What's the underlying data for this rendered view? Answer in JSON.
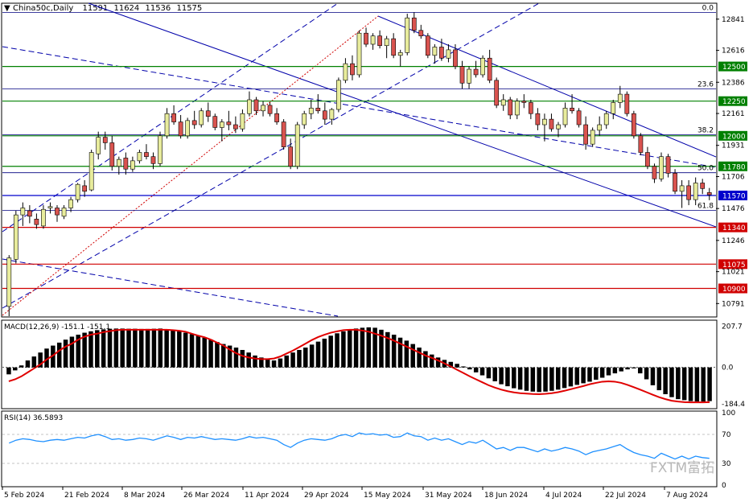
{
  "header": {
    "symbol": "China50c,Daily",
    "open": "11591",
    "high": "11624",
    "low": "11536",
    "close": "11575"
  },
  "watermark": "FXTM富拓",
  "colors": {
    "bull_body": "#e8ec9c",
    "bear_body": "#d9534f",
    "candle_outline": "#000000",
    "support_line": "#d00000",
    "resistance_line": "#008000",
    "current_price_line": "#0000cc",
    "fib_line": "#000080",
    "channel_line": "#0000aa",
    "macd_signal": "#e00000",
    "rsi_line": "#1e90ff"
  },
  "chart_data": {
    "type": "candlestick",
    "ylim": [
      10700,
      12950
    ],
    "y_ticks": [
      12841,
      12616,
      12386,
      12161,
      11931,
      11706,
      11476,
      11246,
      11021,
      10791
    ],
    "x_ticks": [
      "5 Feb 2024",
      "21 Feb 2024",
      "8 Mar 2024",
      "26 Mar 2024",
      "11 Apr 2024",
      "29 Apr 2024",
      "15 May 2024",
      "31 May 2024",
      "18 Jun 2024",
      "4 Jul 2024",
      "22 Jul 2024",
      "7 Aug 2024"
    ],
    "horizontal_levels": [
      {
        "value": 12500,
        "label": "12500",
        "kind": "resistance"
      },
      {
        "value": 12250,
        "label": "12250",
        "kind": "resistance"
      },
      {
        "value": 12000,
        "label": "12000",
        "kind": "resistance"
      },
      {
        "value": 11780,
        "label": "11780",
        "kind": "resistance"
      },
      {
        "value": 11570,
        "label": "11570",
        "kind": "current"
      },
      {
        "value": 11340,
        "label": "11340",
        "kind": "support"
      },
      {
        "value": 11075,
        "label": "11075",
        "kind": "support"
      },
      {
        "value": 10900,
        "label": "10900",
        "kind": "support"
      }
    ],
    "fib_levels": [
      {
        "label": "0.0",
        "value": 12890
      },
      {
        "label": "23.6",
        "value": 12338
      },
      {
        "label": "38.2",
        "value": 12007
      },
      {
        "label": "50.0",
        "value": 11734
      },
      {
        "label": "61.8",
        "value": 11462
      }
    ],
    "fib_anchor": {
      "high": 12890
    },
    "ohlc": [
      [
        10770,
        11140,
        10700,
        11120
      ],
      [
        11110,
        11460,
        11080,
        11430
      ],
      [
        11430,
        11520,
        11350,
        11480
      ],
      [
        11460,
        11500,
        11370,
        11420
      ],
      [
        11400,
        11440,
        11330,
        11360
      ],
      [
        11350,
        11500,
        11330,
        11470
      ],
      [
        11480,
        11520,
        11440,
        11490
      ],
      [
        11480,
        11500,
        11380,
        11430
      ],
      [
        11420,
        11500,
        11400,
        11480
      ],
      [
        11480,
        11560,
        11450,
        11540
      ],
      [
        11540,
        11660,
        11520,
        11650
      ],
      [
        11640,
        11680,
        11560,
        11600
      ],
      [
        11610,
        11900,
        11600,
        11880
      ],
      [
        11870,
        12030,
        11830,
        11990
      ],
      [
        11990,
        12030,
        11900,
        11950
      ],
      [
        11950,
        12000,
        11750,
        11780
      ],
      [
        11780,
        11850,
        11720,
        11830
      ],
      [
        11840,
        11880,
        11720,
        11760
      ],
      [
        11760,
        11850,
        11740,
        11820
      ],
      [
        11820,
        11900,
        11800,
        11880
      ],
      [
        11880,
        11940,
        11830,
        11850
      ],
      [
        11850,
        11880,
        11760,
        11800
      ],
      [
        11800,
        12030,
        11780,
        12000
      ],
      [
        12000,
        12200,
        11980,
        12160
      ],
      [
        12160,
        12220,
        12080,
        12100
      ],
      [
        12100,
        12150,
        11980,
        12000
      ],
      [
        12000,
        12130,
        11980,
        12110
      ],
      [
        12110,
        12180,
        12050,
        12080
      ],
      [
        12080,
        12200,
        12060,
        12180
      ],
      [
        12180,
        12240,
        12100,
        12140
      ],
      [
        12140,
        12160,
        12040,
        12060
      ],
      [
        12060,
        12120,
        11960,
        12100
      ],
      [
        12100,
        12180,
        12040,
        12080
      ],
      [
        12080,
        12140,
        12020,
        12050
      ],
      [
        12050,
        12190,
        12030,
        12160
      ],
      [
        12160,
        12320,
        12140,
        12260
      ],
      [
        12260,
        12280,
        12150,
        12180
      ],
      [
        12180,
        12250,
        12140,
        12220
      ],
      [
        12220,
        12240,
        12140,
        12160
      ],
      [
        12160,
        12200,
        12080,
        12100
      ],
      [
        12100,
        12120,
        11900,
        11920
      ],
      [
        11920,
        11980,
        11760,
        11780
      ],
      [
        11780,
        12100,
        11760,
        12080
      ],
      [
        12080,
        12180,
        12050,
        12160
      ],
      [
        12160,
        12260,
        12120,
        12200
      ],
      [
        12200,
        12300,
        12160,
        12180
      ],
      [
        12180,
        12240,
        12080,
        12120
      ],
      [
        12120,
        12200,
        12080,
        12190
      ],
      [
        12190,
        12420,
        12170,
        12400
      ],
      [
        12400,
        12560,
        12380,
        12520
      ],
      [
        12520,
        12580,
        12400,
        12440
      ],
      [
        12440,
        12760,
        12420,
        12740
      ],
      [
        12740,
        12780,
        12640,
        12660
      ],
      [
        12660,
        12740,
        12620,
        12720
      ],
      [
        12720,
        12760,
        12630,
        12650
      ],
      [
        12650,
        12720,
        12560,
        12700
      ],
      [
        12700,
        12740,
        12560,
        12580
      ],
      [
        12580,
        12620,
        12500,
        12600
      ],
      [
        12600,
        12880,
        12580,
        12850
      ],
      [
        12850,
        12890,
        12740,
        12760
      ],
      [
        12760,
        12800,
        12700,
        12720
      ],
      [
        12720,
        12740,
        12560,
        12580
      ],
      [
        12580,
        12660,
        12520,
        12640
      ],
      [
        12640,
        12700,
        12540,
        12560
      ],
      [
        12560,
        12660,
        12530,
        12620
      ],
      [
        12620,
        12660,
        12480,
        12500
      ],
      [
        12500,
        12540,
        12340,
        12380
      ],
      [
        12380,
        12500,
        12340,
        12480
      ],
      [
        12480,
        12540,
        12420,
        12440
      ],
      [
        12440,
        12580,
        12420,
        12560
      ],
      [
        12560,
        12620,
        12380,
        12400
      ],
      [
        12400,
        12420,
        12200,
        12220
      ],
      [
        12220,
        12300,
        12180,
        12260
      ],
      [
        12260,
        12280,
        12120,
        12150
      ],
      [
        12150,
        12270,
        12120,
        12250
      ],
      [
        12250,
        12300,
        12200,
        12240
      ],
      [
        12240,
        12260,
        12120,
        12160
      ],
      [
        12160,
        12200,
        12040,
        12080
      ],
      [
        12080,
        12160,
        11960,
        12120
      ],
      [
        12120,
        12160,
        12030,
        12050
      ],
      [
        12050,
        12100,
        11990,
        12080
      ],
      [
        12080,
        12240,
        12060,
        12200
      ],
      [
        12200,
        12300,
        12160,
        12180
      ],
      [
        12180,
        12200,
        12060,
        12080
      ],
      [
        12080,
        12140,
        11900,
        11940
      ],
      [
        11940,
        12060,
        11920,
        12040
      ],
      [
        12040,
        12140,
        12000,
        12080
      ],
      [
        12080,
        12180,
        12050,
        12160
      ],
      [
        12160,
        12260,
        12120,
        12240
      ],
      [
        12240,
        12360,
        12200,
        12300
      ],
      [
        12300,
        12320,
        12140,
        12160
      ],
      [
        12160,
        12180,
        11980,
        12000
      ],
      [
        12000,
        12020,
        11860,
        11880
      ],
      [
        11880,
        11920,
        11760,
        11780
      ],
      [
        11780,
        11800,
        11660,
        11690
      ],
      [
        11690,
        11880,
        11670,
        11850
      ],
      [
        11850,
        11870,
        11700,
        11730
      ],
      [
        11730,
        11760,
        11580,
        11600
      ],
      [
        11600,
        11680,
        11480,
        11640
      ],
      [
        11640,
        11680,
        11500,
        11540
      ],
      [
        11540,
        11700,
        11500,
        11660
      ],
      [
        11660,
        11690,
        11580,
        11620
      ],
      [
        11591,
        11624,
        11536,
        11575
      ]
    ],
    "macd": {
      "label": "MACD(12,26,9) -151.1 -151.1",
      "ylim": [
        -200,
        230
      ],
      "y_ticks": [
        207.7,
        0.0,
        -184.4
      ],
      "hist": [
        -35,
        -15,
        10,
        35,
        55,
        75,
        95,
        110,
        125,
        140,
        155,
        165,
        175,
        182,
        188,
        192,
        195,
        196,
        196,
        195,
        195,
        194,
        194,
        195,
        196,
        193,
        188,
        182,
        175,
        168,
        160,
        150,
        140,
        128,
        118,
        110,
        100,
        88,
        75,
        60,
        50,
        40,
        35,
        45,
        60,
        75,
        88,
        100,
        115,
        130,
        145,
        160,
        172,
        182,
        190,
        196,
        200,
        202,
        200,
        190,
        178,
        165,
        150,
        135,
        118,
        100,
        82,
        65,
        50,
        38,
        28,
        18,
        5,
        -10,
        -25,
        -40,
        -55,
        -70,
        -85,
        -95,
        -105,
        -112,
        -118,
        -122,
        -124,
        -122,
        -118,
        -112,
        -104,
        -96,
        -88,
        -80,
        -72,
        -62,
        -52,
        -40,
        -30,
        -20,
        -10,
        -5,
        -30,
        -60,
        -90,
        -115,
        -135,
        -150,
        -160,
        -165,
        -170,
        -172,
        -172,
        -170
      ],
      "signal": [
        -70,
        -60,
        -45,
        -25,
        -5,
        15,
        40,
        60,
        85,
        105,
        120,
        140,
        155,
        165,
        170,
        178,
        183,
        188,
        190,
        190,
        190,
        190,
        190,
        190,
        190,
        190,
        188,
        185,
        180,
        170,
        160,
        152,
        140,
        125,
        110,
        90,
        72,
        58,
        50,
        45,
        42,
        42,
        45,
        55,
        70,
        85,
        102,
        120,
        138,
        153,
        165,
        175,
        182,
        188,
        190,
        190,
        186,
        180,
        170,
        160,
        148,
        135,
        120,
        105,
        90,
        75,
        60,
        48,
        35,
        20,
        5,
        -12,
        -28,
        -45,
        -60,
        -75,
        -90,
        -102,
        -112,
        -120,
        -126,
        -130,
        -132,
        -134,
        -135,
        -133,
        -130,
        -125,
        -118,
        -110,
        -102,
        -94,
        -85,
        -78,
        -72,
        -70,
        -72,
        -78,
        -88,
        -100,
        -112,
        -125,
        -138,
        -150,
        -160,
        -168,
        -172,
        -175,
        -176,
        -176,
        -176,
        -175
      ]
    },
    "rsi": {
      "label": "RSI(14) 36.5893",
      "ylim": [
        0,
        100
      ],
      "y_ticks": [
        100,
        70,
        30,
        0
      ],
      "values": [
        58,
        62,
        64,
        63,
        61,
        60,
        62,
        63,
        62,
        64,
        66,
        65,
        68,
        70,
        67,
        63,
        64,
        62,
        63,
        65,
        64,
        62,
        65,
        68,
        66,
        63,
        66,
        65,
        67,
        65,
        63,
        64,
        63,
        62,
        64,
        67,
        65,
        66,
        64,
        62,
        56,
        52,
        58,
        62,
        64,
        63,
        62,
        64,
        68,
        70,
        67,
        72,
        70,
        71,
        69,
        70,
        66,
        67,
        72,
        68,
        67,
        62,
        65,
        62,
        64,
        60,
        56,
        60,
        58,
        62,
        56,
        50,
        52,
        48,
        52,
        52,
        49,
        46,
        50,
        47,
        49,
        52,
        50,
        47,
        42,
        46,
        48,
        50,
        53,
        56,
        50,
        45,
        42,
        40,
        37,
        44,
        40,
        36,
        40,
        36,
        40,
        38,
        37
      ]
    }
  }
}
